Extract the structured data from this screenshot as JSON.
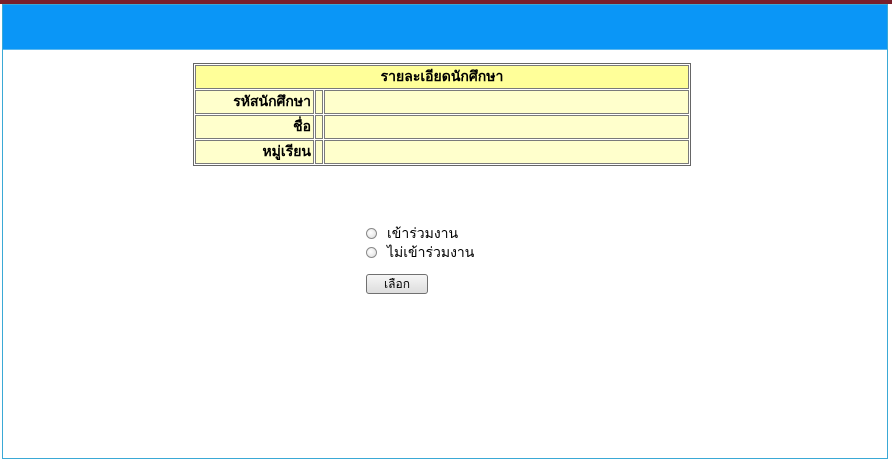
{
  "student_details": {
    "title": "รายละเอียดนักศึกษา",
    "rows": [
      {
        "label": "รหัสนักศึกษา",
        "value": ""
      },
      {
        "label": "ชื่อ",
        "value": ""
      },
      {
        "label": "หมู่เรียน",
        "value": ""
      }
    ]
  },
  "attendance": {
    "options": [
      {
        "label": "เข้าร่วมงาน",
        "checked": false
      },
      {
        "label": "ไม่เข้าร่วมงาน",
        "checked": false
      }
    ],
    "submit_label": "เลือก"
  },
  "colors": {
    "header_bar": "#0a96f7",
    "table_title_bg": "#ffff99",
    "table_cell_bg": "#ffffcc",
    "frame_border": "#3aa9d6"
  }
}
